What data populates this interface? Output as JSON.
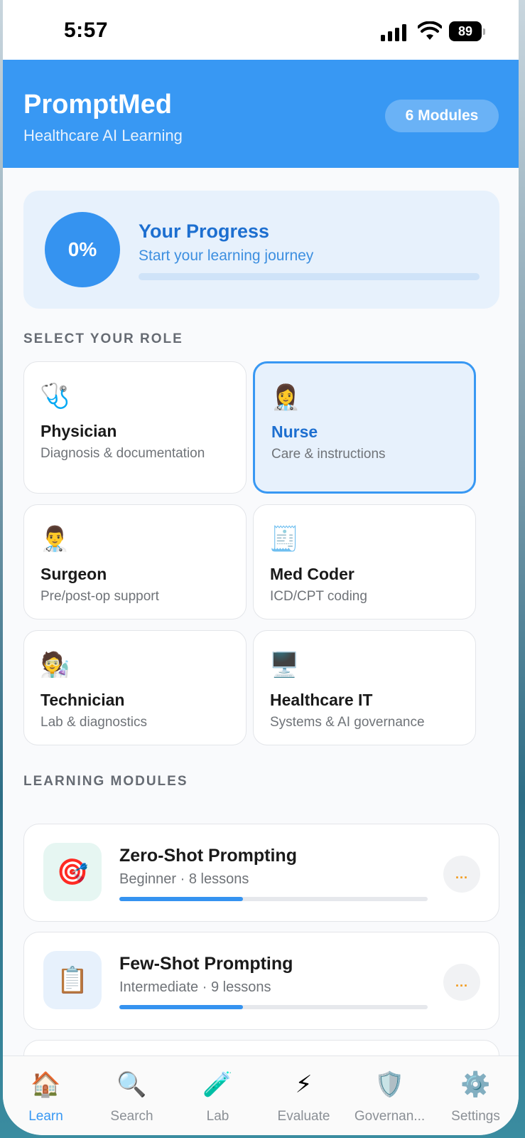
{
  "status_bar": {
    "time": "5:57",
    "battery": "89"
  },
  "header": {
    "title": "PromptMed",
    "subtitle": "Healthcare AI Learning",
    "modules_badge": "6 Modules"
  },
  "progress": {
    "percent_label": "0%",
    "fraction": 0,
    "title": "Your Progress",
    "subtitle": "Start your learning journey"
  },
  "roles_section": {
    "label": "SELECT YOUR ROLE",
    "roles": [
      {
        "name": "Physician",
        "desc": "Diagnosis & documentation",
        "icon": "stethoscope-icon",
        "glyph": "🩺",
        "selected": false
      },
      {
        "name": "Nurse",
        "desc": "Care & instructions",
        "icon": "nurse-icon",
        "glyph": "👩‍⚕️",
        "selected": true
      },
      {
        "name": "Surgeon",
        "desc": "Pre/post-op support",
        "icon": "surgeon-icon",
        "glyph": "👨‍⚕️",
        "selected": false
      },
      {
        "name": "Med Coder",
        "desc": "ICD/CPT coding",
        "icon": "receipt-icon",
        "glyph": "🧾",
        "selected": false
      },
      {
        "name": "Technician",
        "desc": "Lab & diagnostics",
        "icon": "lab-technician-icon",
        "glyph": "🧑‍🔬",
        "selected": false
      },
      {
        "name": "Healthcare IT",
        "desc": "Systems & AI governance",
        "icon": "desktop-computer-icon",
        "glyph": "🖥️",
        "selected": false
      }
    ]
  },
  "modules_section": {
    "label": "LEARNING MODULES",
    "modules": [
      {
        "title": "Zero-Shot Prompting",
        "meta": "Beginner · 8 lessons",
        "progress": 0.4,
        "icon": "target-icon",
        "glyph": "🎯",
        "thumb_color": "#e6f6f2"
      },
      {
        "title": "Few-Shot Prompting",
        "meta": "Intermediate · 9 lessons",
        "progress": 0.4,
        "icon": "clipboard-icon",
        "glyph": "📋",
        "thumb_color": "#e7f1fc"
      }
    ],
    "more_label": "..."
  },
  "tabs": [
    {
      "label": "Learn",
      "icon": "house-icon",
      "glyph": "🏠",
      "active": true
    },
    {
      "label": "Search",
      "icon": "magnifier-icon",
      "glyph": "🔍",
      "active": false
    },
    {
      "label": "Lab",
      "icon": "test-tube-icon",
      "glyph": "🧪",
      "active": false
    },
    {
      "label": "Evaluate",
      "icon": "lightning-icon",
      "glyph": "⚡",
      "active": false
    },
    {
      "label": "Governan...",
      "icon": "shield-icon",
      "glyph": "🛡️",
      "active": false
    },
    {
      "label": "Settings",
      "icon": "gear-icon",
      "glyph": "⚙️",
      "active": false
    }
  ],
  "colors": {
    "accent": "#3898f3",
    "accent_dark": "#1d6fd0",
    "more_dots": "#f39a1a"
  }
}
